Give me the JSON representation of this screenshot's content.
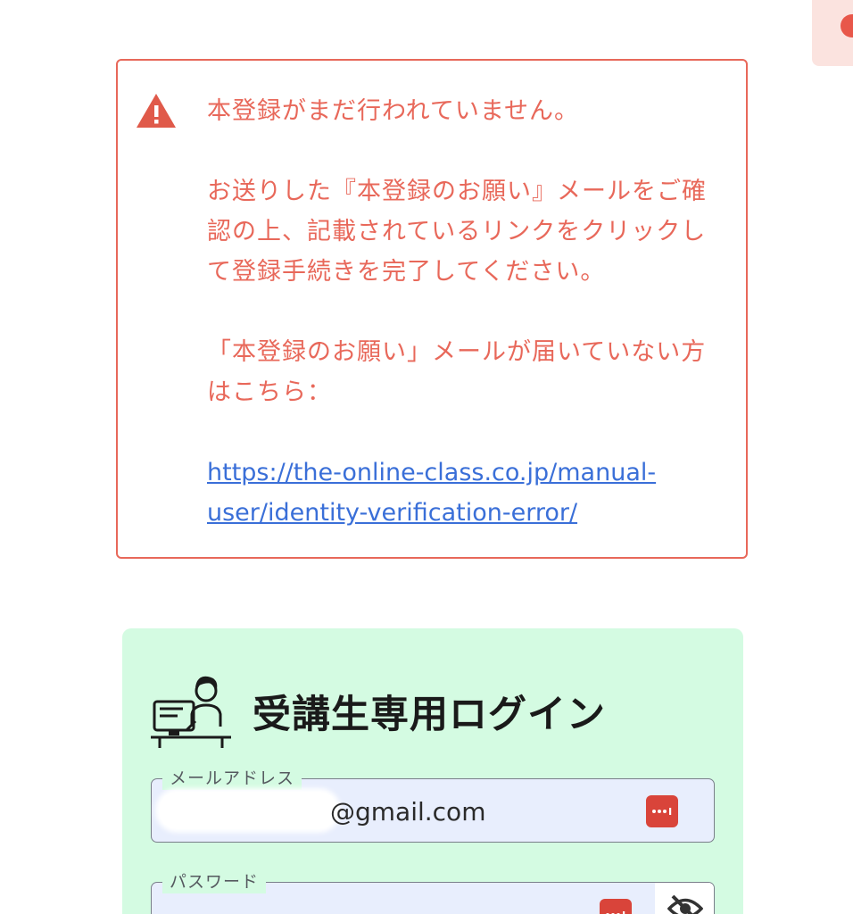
{
  "alert": {
    "icon": "warning-triangle-icon",
    "lines": [
      "本登録がまだ行われていません。",
      "お送りした『本登録のお願い』メールをご確認の上、記載されているリンクをクリックして登録手続きを完了してください。",
      "「本登録のお願い」メールが届いていない方はこちら："
    ],
    "link_text": "https://the-online-class.co.jp/manual-user/identity-verification-error/",
    "color": "#e8685a",
    "link_color": "#3a6fd8"
  },
  "login": {
    "title": "受講生専用ログイン",
    "illustration": "student-at-computer-icon",
    "email": {
      "label": "メールアドレス",
      "value": "@gmail.com"
    },
    "password": {
      "label": "パスワード",
      "value": ""
    },
    "background": "#d4fbe2",
    "field_background": "#e8eefd"
  },
  "icons": {
    "password_manager": "password-manager-icon",
    "visibility_toggle": "eye-slash-icon"
  }
}
